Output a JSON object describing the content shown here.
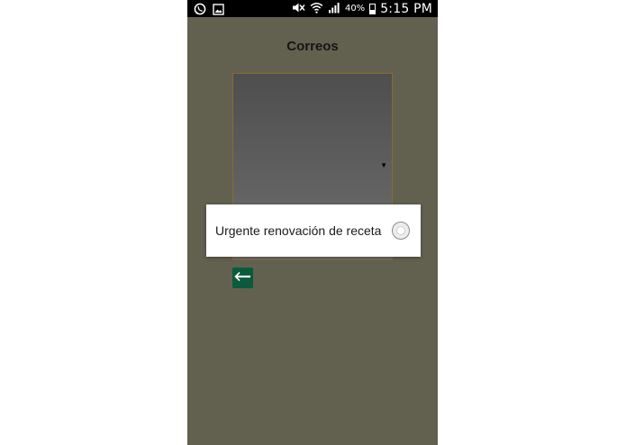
{
  "status_bar": {
    "battery_percent": "40%",
    "battery_level": 0.4,
    "time": "5:15 PM",
    "icons_left": [
      "whatsapp-icon",
      "gallery-icon"
    ],
    "icons_right": [
      "mute-icon",
      "wifi-icon",
      "signal-icon",
      "battery-icon"
    ]
  },
  "screen": {
    "title": "Correos",
    "spinner_arrow": "▼",
    "back_button_icon": "arrow-left-icon"
  },
  "dialog": {
    "option_label": "Urgente renovación de receta",
    "option_selected": false
  },
  "colors": {
    "background": "#626150",
    "status_bar": "#000000",
    "back_button": "#0b5a3c",
    "dialog": "#ffffff"
  }
}
